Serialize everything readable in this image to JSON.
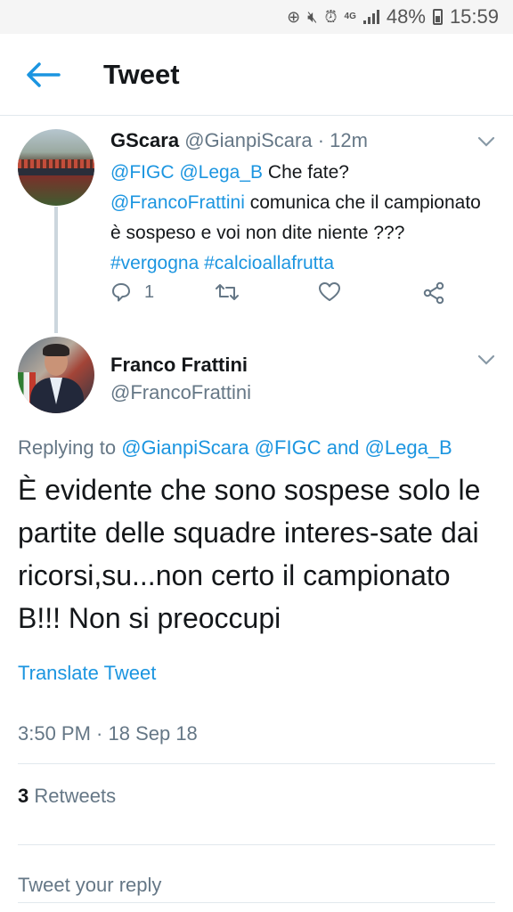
{
  "status_bar": {
    "network": "4G",
    "battery": "48%",
    "time": "15:59",
    "icons": [
      "add-circle-icon",
      "mute-icon",
      "alarm-icon",
      "network-icon",
      "signal-icon",
      "battery-icon"
    ]
  },
  "header": {
    "title": "Tweet",
    "accent": "#1b95e0"
  },
  "tweet1": {
    "name": "GScara",
    "handle": "@GianpiScara",
    "dot": "·",
    "time": "12m",
    "mention1": "@FIGC",
    "mention2": "@Lega_B",
    "text1": "Che fate?",
    "mention3": "@FrancoFrattini",
    "text2": "comunica che il campionato è sospeso e voi non dite niente ???",
    "hashtag1": "#vergogna",
    "hashtag2": "#calcioallafrutta",
    "reply_count": "1"
  },
  "tweet2": {
    "name": "Franco Frattini",
    "handle": "@FrancoFrattini",
    "replying_prefix": "Replying to",
    "replying_users": "@GianpiScara @FIGC and @Lega_B",
    "text": "È evidente che sono sospese solo le partite delle squadre interes-sate dai ricorsi,su...non certo il campionato B!!! Non si preoccupi",
    "translate": "Translate Tweet",
    "timestamp": "3:50 PM · 18 Sep 18",
    "retweets_count": "3",
    "retweets_label": "Retweets"
  },
  "reply": {
    "placeholder": "Tweet your reply"
  }
}
